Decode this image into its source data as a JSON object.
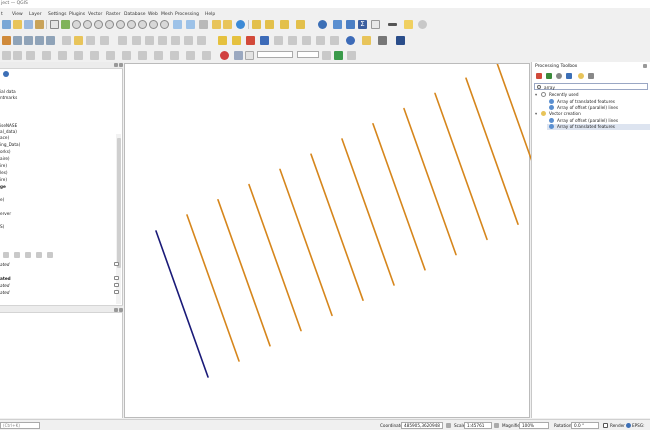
{
  "window": {
    "title": "ject — QGIS"
  },
  "menubar": {
    "items": [
      "t",
      "View",
      "Layer",
      "Settings",
      "Plugins",
      "Vector",
      "Raster",
      "Database",
      "Web",
      "Mesh",
      "Processing",
      "Help"
    ]
  },
  "layers_panel": {
    "rows": [
      "ial data",
      "ntmarks",
      "iseNASE",
      "al_data)",
      "ace)",
      "ing_Data)",
      "orks)",
      "aire)",
      "ire)",
      "les)",
      "ire)",
      "ge",
      "e)",
      "erver",
      "S)"
    ]
  },
  "browser_panel": {
    "rows": [
      {
        "label": "ated",
        "style": "italic"
      },
      {
        "label": "ated",
        "style": "bold"
      },
      {
        "label": "ated",
        "style": "italic"
      },
      {
        "label": "ated",
        "style": "italic"
      }
    ]
  },
  "processing_toolbox": {
    "title": "Processing Toolbox",
    "search_value": "array",
    "groups": [
      {
        "label": "Recently used",
        "items": [
          "Array of translated features",
          "Array of offset (parallel) lines"
        ]
      },
      {
        "label": "Vector creation",
        "items": [
          "Array of offset (parallel) lines",
          "Array of translated features"
        ]
      }
    ]
  },
  "statusbar": {
    "search_placeholder": "(Ctrl+K)",
    "coordinate_label": "Coordinate",
    "coordinate_value": "485905,3620948",
    "scale_label": "Scale",
    "scale_value": "1:45761",
    "magnifier_label": "Magnifier",
    "magnifier_value": "100%",
    "rotation_label": "Rotation",
    "rotation_value": "0.0 °",
    "render_label": "Render",
    "crs_label": "EPSG:"
  },
  "map": {
    "original_line_color": "#1a1a78",
    "offset_line_color": "#d6861c"
  },
  "colors": {
    "accent": "#3a6fc4",
    "selection": "#dde4f0"
  }
}
